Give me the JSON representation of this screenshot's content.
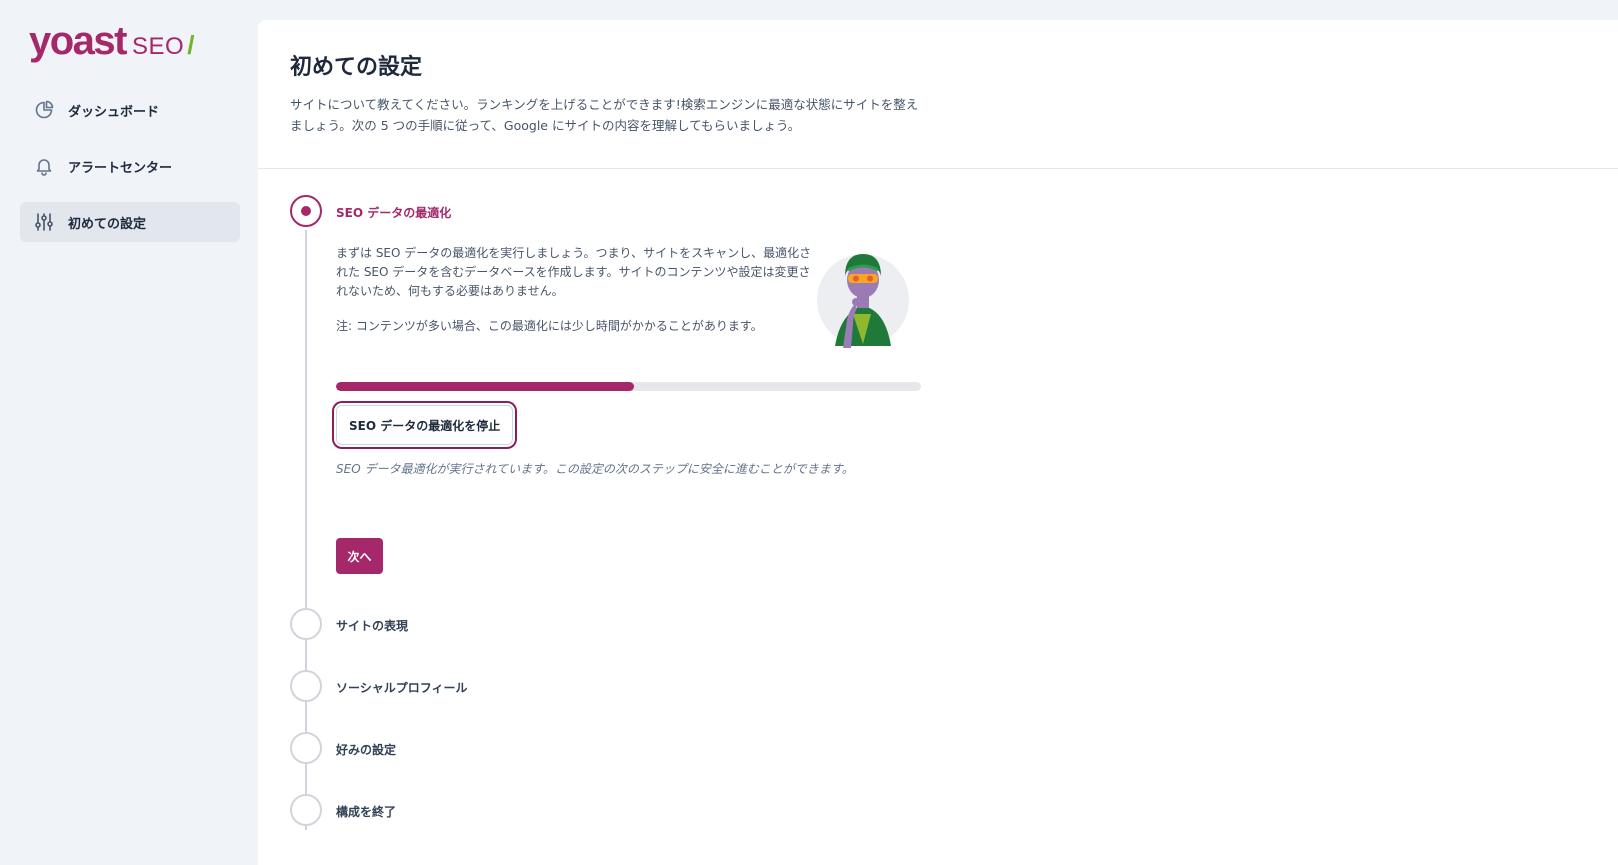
{
  "logo": {
    "brand": "yoast",
    "product": "SEO",
    "slash": "/"
  },
  "sidebar": {
    "items": [
      {
        "label": "ダッシュボード",
        "icon": "pie-chart-icon",
        "active": false
      },
      {
        "label": "アラートセンター",
        "icon": "bell-icon",
        "active": false
      },
      {
        "label": "初めての設定",
        "icon": "sliders-icon",
        "active": true
      }
    ]
  },
  "header": {
    "title": "初めての設定",
    "description": "サイトについて教えてください。ランキングを上げることができます!検索エンジンに最適な状態にサイトを整えましょう。次の 5 つの手順に従って、Google にサイトの内容を理解してもらいましょう。"
  },
  "steps": [
    {
      "label": "SEO データの最適化",
      "active": true
    },
    {
      "label": "サイトの表現",
      "active": false
    },
    {
      "label": "ソーシャルプロフィール",
      "active": false
    },
    {
      "label": "好みの設定",
      "active": false
    },
    {
      "label": "構成を終了",
      "active": false
    }
  ],
  "optimization": {
    "text": "まずは SEO データの最適化を実行しましょう。つまり、サイトをスキャンし、最適化された SEO データを含むデータベースを作成します。サイトのコンテンツや設定は変更されないため、何もする必要はありません。",
    "note": "注: コンテンツが多い場合、この最適化には少し時間がかかることがあります。",
    "progress_fraction": 0.51,
    "stop_button_label": "SEO データの最適化を停止",
    "status_text": "SEO データ最適化が実行されています。この設定の次のステップに安全に進むことができます。",
    "next_button_label": "次へ"
  },
  "colors": {
    "brand": "#a4286a",
    "accent_green": "#77b227",
    "background": "#f0f3f7",
    "active_nav": "#e2e6ed"
  }
}
